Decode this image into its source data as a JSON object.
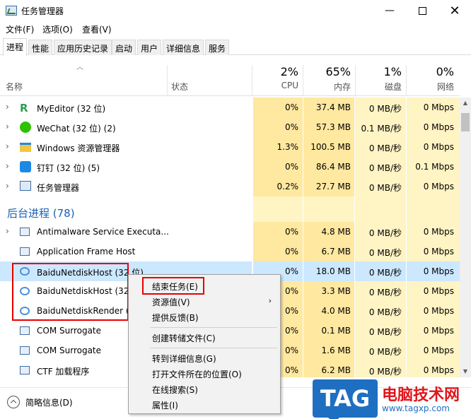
{
  "window": {
    "title": "任务管理器",
    "controls": {
      "minimize": "—",
      "close": "✕"
    }
  },
  "menu": [
    "文件(F)",
    "选项(O)",
    "查看(V)"
  ],
  "tabs": [
    "进程",
    "性能",
    "应用历史记录",
    "启动",
    "用户",
    "详细信息",
    "服务"
  ],
  "active_tab": "进程",
  "columns": {
    "name": "名称",
    "status": "状态",
    "cpu": {
      "pct": "2%",
      "label": "CPU"
    },
    "memory": {
      "pct": "65%",
      "label": "内存"
    },
    "disk": {
      "pct": "1%",
      "label": "磁盘"
    },
    "network": {
      "pct": "0%",
      "label": "网络"
    }
  },
  "apps": [
    {
      "name": "MyEditor (32 位)",
      "cpu": "0%",
      "mem": "37.4 MB",
      "disk": "0 MB/秒",
      "net": "0 Mbps",
      "icon": "myeditor-icon",
      "color": "#2e9d4f"
    },
    {
      "name": "WeChat (32 位) (2)",
      "cpu": "0%",
      "mem": "57.3 MB",
      "disk": "0.1 MB/秒",
      "net": "0 Mbps",
      "icon": "wechat-icon",
      "color": "#2dc100"
    },
    {
      "name": "Windows 资源管理器",
      "cpu": "1.3%",
      "mem": "100.5 MB",
      "disk": "0 MB/秒",
      "net": "0 Mbps",
      "icon": "folder-icon",
      "color": "#f4c542"
    },
    {
      "name": "钉钉 (32 位) (5)",
      "cpu": "0%",
      "mem": "86.4 MB",
      "disk": "0 MB/秒",
      "net": "0.1 Mbps",
      "icon": "dingtalk-icon",
      "color": "#1e88e5"
    },
    {
      "name": "任务管理器",
      "cpu": "0.2%",
      "mem": "27.7 MB",
      "disk": "0 MB/秒",
      "net": "0 Mbps",
      "icon": "taskmanager-icon",
      "color": "#3a6ea5"
    }
  ],
  "background_group": "后台进程 (78)",
  "background": [
    {
      "name": "Antimalware Service Executa...",
      "cpu": "0%",
      "mem": "4.8 MB",
      "disk": "0 MB/秒",
      "net": "0 Mbps",
      "icon": "service-icon",
      "expandable": true
    },
    {
      "name": "Application Frame Host",
      "cpu": "0%",
      "mem": "6.7 MB",
      "disk": "0 MB/秒",
      "net": "0 Mbps",
      "icon": "service-icon",
      "expandable": false
    },
    {
      "name": "BaiduNetdiskHost (32 位)",
      "cpu": "0%",
      "mem": "18.0 MB",
      "disk": "0 MB/秒",
      "net": "0 Mbps",
      "icon": "baidu-netdisk-icon",
      "expandable": false
    },
    {
      "name": "BaiduNetdiskHost (32",
      "cpu": "0%",
      "mem": "3.3 MB",
      "disk": "0 MB/秒",
      "net": "0 Mbps",
      "icon": "baidu-netdisk-icon",
      "expandable": false
    },
    {
      "name": "BaiduNetdiskRender (",
      "cpu": "0%",
      "mem": "4.0 MB",
      "disk": "0 MB/秒",
      "net": "0 Mbps",
      "icon": "baidu-netdisk-icon",
      "expandable": false
    },
    {
      "name": "COM Surrogate",
      "cpu": "0%",
      "mem": "0.1 MB",
      "disk": "0 MB/秒",
      "net": "0 Mbps",
      "icon": "service-icon",
      "expandable": false
    },
    {
      "name": "COM Surrogate",
      "cpu": "0%",
      "mem": "1.6 MB",
      "disk": "0 MB/秒",
      "net": "0 Mbps",
      "icon": "service-icon",
      "expandable": false
    },
    {
      "name": "CTF 加载程序",
      "cpu": "0%",
      "mem": "6.2 MB",
      "disk": "0 MB/秒",
      "net": "0 Mbps",
      "icon": "ctf-icon",
      "expandable": false
    }
  ],
  "context_menu": {
    "end_task": "结束任务(E)",
    "resource_values": "资源值(V)",
    "feedback": "提供反馈(B)",
    "create_dump": "创建转储文件(C)",
    "go_to_details": "转到详细信息(G)",
    "open_file_location": "打开文件所在的位置(O)",
    "search_online": "在线搜索(S)",
    "properties": "属性(I)"
  },
  "footer": {
    "label": "简略信息(D)"
  },
  "watermark": {
    "tag": "TAG",
    "title": "电脑技术网",
    "url": "www.tagxp.com"
  },
  "colors": {
    "heat_light": "#fff4c4",
    "heat_mid": "#ffe8a0",
    "selected": "#cce8ff",
    "group": "#1a5fb4",
    "highlight_box": "#e60000"
  }
}
